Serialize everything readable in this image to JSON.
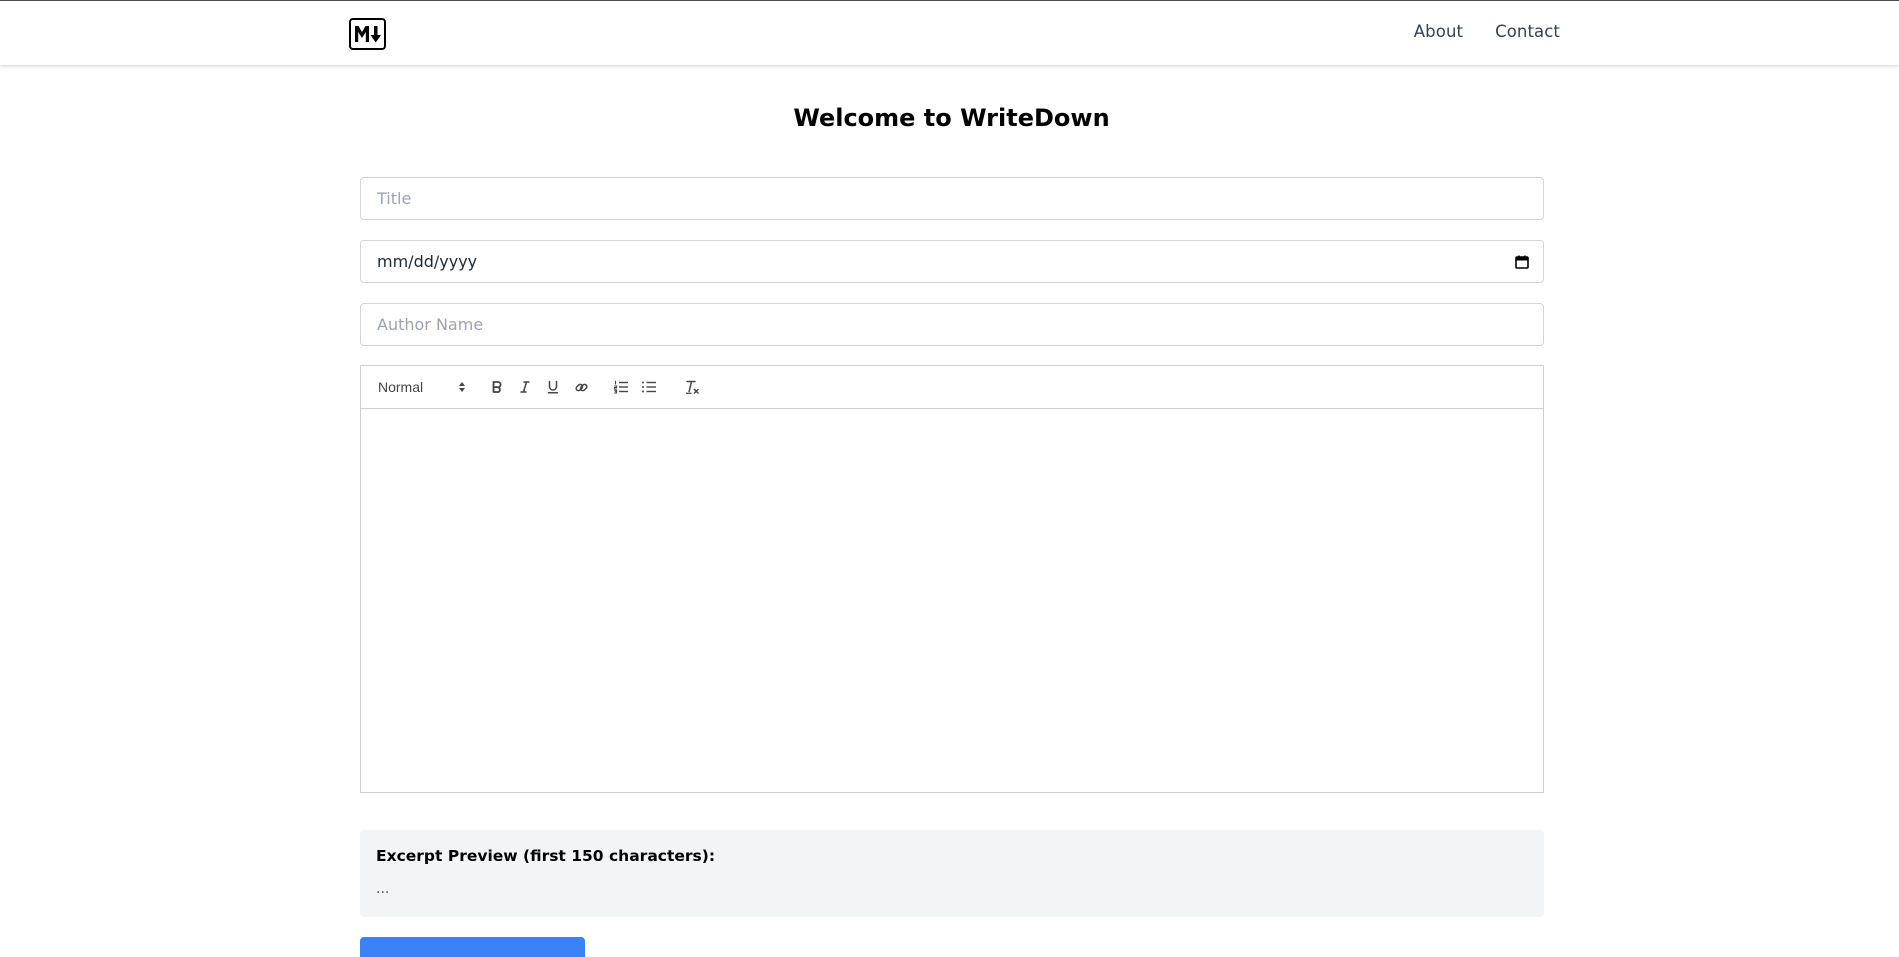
{
  "header": {
    "logo_alt": "M↓",
    "nav": [
      {
        "label": "About"
      },
      {
        "label": "Contact"
      }
    ]
  },
  "main": {
    "title": "Welcome to WriteDown",
    "title_field": {
      "placeholder": "Title",
      "value": ""
    },
    "date_field": {
      "placeholder": "mm/dd/yyyy",
      "value": ""
    },
    "author_field": {
      "placeholder": "Author Name",
      "value": ""
    },
    "editor": {
      "format_select": "Normal",
      "toolbar_icons": [
        "bold-icon",
        "italic-icon",
        "underline-icon",
        "link-icon",
        "ordered-list-icon",
        "bullet-list-icon",
        "clear-format-icon"
      ],
      "content": ""
    },
    "excerpt": {
      "heading": "Excerpt Preview (first 150 characters):",
      "text": "..."
    }
  },
  "colors": {
    "accent": "#3b82f6",
    "excerpt_bg": "#f3f4f6",
    "nav_text": "#334155",
    "border": "#d4d4d8"
  }
}
